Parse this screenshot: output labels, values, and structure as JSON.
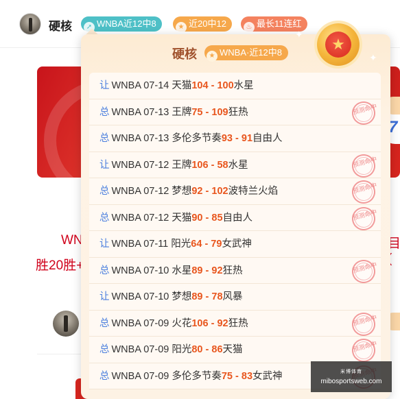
{
  "header": {
    "username": "硬核",
    "tags": [
      {
        "label": "WNBA近12中8",
        "icon": "arrow-up-icon"
      },
      {
        "label": "近20中12",
        "icon": "star-icon"
      },
      {
        "label": "最长11连红",
        "icon": "flame-icon"
      }
    ]
  },
  "background": {
    "text_line1_left": "WN",
    "text_line1_right": "目(",
    "text_line2": "胜20胜+"
  },
  "popup": {
    "title": "硬核",
    "tag_label": "WNBA·近12中8",
    "stamp_text": "预测命中",
    "rows": [
      {
        "type": "让",
        "league": "WNBA",
        "date": "07-14",
        "home": "天猫",
        "score": "104 - 100",
        "away": "水星",
        "hit": false
      },
      {
        "type": "总",
        "league": "WNBA",
        "date": "07-13",
        "home": "王牌",
        "score": "75 - 109",
        "away": "狂热",
        "hit": true
      },
      {
        "type": "总",
        "league": "WNBA",
        "date": "07-13",
        "home": "多伦多节奏",
        "score": "93 - 91",
        "away": "自由人",
        "hit": false
      },
      {
        "type": "让",
        "league": "WNBA",
        "date": "07-12",
        "home": "王牌",
        "score": "106 - 58",
        "away": "水星",
        "hit": true
      },
      {
        "type": "总",
        "league": "WNBA",
        "date": "07-12",
        "home": "梦想",
        "score": "92 - 102",
        "away": "波特兰火焰",
        "hit": true
      },
      {
        "type": "总",
        "league": "WNBA",
        "date": "07-12",
        "home": "天猫",
        "score": "90 - 85",
        "away": "自由人",
        "hit": true
      },
      {
        "type": "让",
        "league": "WNBA",
        "date": "07-11",
        "home": "阳光",
        "score": "64 - 79",
        "away": "女武神",
        "hit": false
      },
      {
        "type": "总",
        "league": "WNBA",
        "date": "07-10",
        "home": "水星",
        "score": "89 - 92",
        "away": "狂热",
        "hit": true
      },
      {
        "type": "让",
        "league": "WNBA",
        "date": "07-10",
        "home": "梦想",
        "score": "89 - 78",
        "away": "风暴",
        "hit": false
      },
      {
        "type": "总",
        "league": "WNBA",
        "date": "07-09",
        "home": "火花",
        "score": "106 - 92",
        "away": "狂热",
        "hit": true
      },
      {
        "type": "总",
        "league": "WNBA",
        "date": "07-09",
        "home": "阳光",
        "score": "80 - 86",
        "away": "天猫",
        "hit": true
      },
      {
        "type": "总",
        "league": "WNBA",
        "date": "07-09",
        "home": "多伦多节奏",
        "score": "75 - 83",
        "away": "女武神",
        "hit": true
      }
    ]
  },
  "watermark": {
    "line1": "米博体育",
    "line2": "mibosportsweb.com"
  }
}
